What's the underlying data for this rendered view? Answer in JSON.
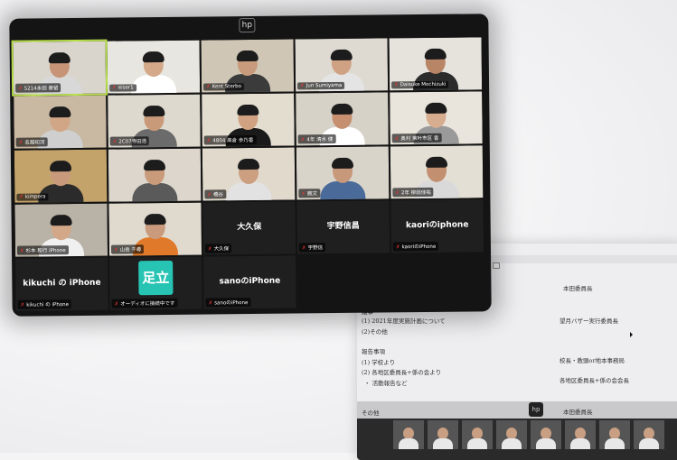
{
  "colors": {
    "active_speaker_border": "#b8e04a",
    "muted_mic": "#e33333",
    "badge_teal": "#27c4b4"
  },
  "front_logo": "hp",
  "back_logo": "hp",
  "meeting": {
    "tiles": [
      {
        "name": "5214永田 泰留"
      },
      {
        "name": "eiser1"
      },
      {
        "name": "Kent Sterbo"
      },
      {
        "name": "Jun Sumiyama"
      },
      {
        "name": "Daisuke Mochizuki"
      },
      {
        "name": "名越知河"
      },
      {
        "name": "2C07寺田浩"
      },
      {
        "name": "4804 高倉 歩乃香"
      },
      {
        "name": "4年 清水 健"
      },
      {
        "name": "奥村 茉叶市区 香"
      },
      {
        "name": "kimpera"
      },
      {
        "name": ""
      },
      {
        "name": "橋谷"
      },
      {
        "name": "腕文"
      },
      {
        "name": "2年 柳田佳祐"
      },
      {
        "name": "杉本 和行 iPhone"
      },
      {
        "name": "山岳 千尋"
      },
      {
        "name": "大久保",
        "big": "大久保"
      },
      {
        "name": "宇野信",
        "big": "宇野信昌"
      },
      {
        "name": "kaoriのiPhone",
        "big": "kaoriのiphone"
      },
      {
        "name": "kikuchi の iPhone",
        "big": "kikuchi の iPhone"
      },
      {
        "name": "オーディオに接続中です",
        "badge": "足立"
      },
      {
        "name": "sanoのiPhone",
        "big": "sanoのiPhone"
      }
    ]
  },
  "document": {
    "lines": [
      "本田委員長",
      "議事",
      "(1) 2021年度実施計画について",
      "(2)その他",
      "望月バザー実行委員長",
      "報告事項",
      "(1) 学校より",
      "(2) 各地区委員長+係の会より",
      "・ 活動報告など",
      "校長・教頭or地本事務局",
      "各地区委員長+係の会会長",
      "その他",
      "本田委員長"
    ]
  }
}
